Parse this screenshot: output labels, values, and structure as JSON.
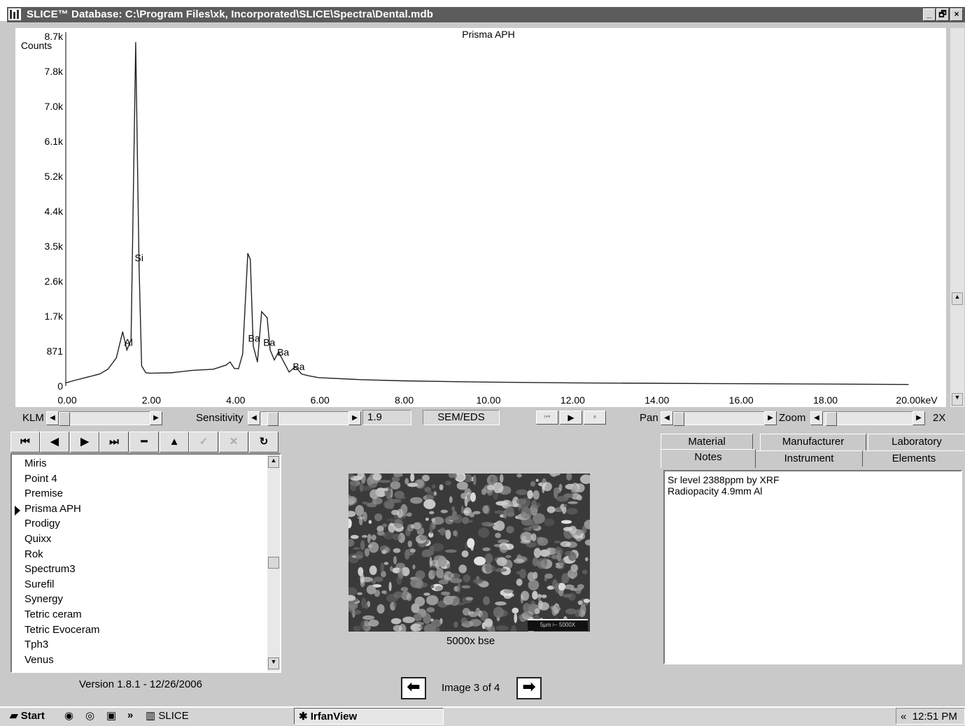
{
  "window": {
    "title": "SLICE™ Database: C:\\Program Files\\xk, Incorporated\\SLICE\\Spectra\\Dental.mdb",
    "btn_min": "_",
    "btn_max": "🗗",
    "btn_close": "×"
  },
  "chart_data": {
    "type": "line",
    "title": "Prisma APH",
    "ylabel": "Counts",
    "xlabel": "keV",
    "xlim": [
      0,
      20
    ],
    "ylim": [
      0,
      8700
    ],
    "y_ticks": [
      "8.7k",
      "7.8k",
      "7.0k",
      "6.1k",
      "5.2k",
      "4.4k",
      "3.5k",
      "2.6k",
      "1.7k",
      "871",
      "0"
    ],
    "x_ticks": [
      "0.00",
      "2.00",
      "4.00",
      "6.00",
      "8.00",
      "10.00",
      "12.00",
      "14.00",
      "16.00",
      "18.00",
      "20.00keV"
    ],
    "series": [
      {
        "x": [
          0.0,
          0.2,
          0.5,
          0.8,
          1.0,
          1.2,
          1.35,
          1.45,
          1.55,
          1.6,
          1.66,
          1.74,
          1.8,
          1.9,
          2.0,
          2.5,
          3.0,
          3.5,
          3.8,
          3.9,
          4.0,
          4.1,
          4.2,
          4.32,
          4.38,
          4.45,
          4.55,
          4.65,
          4.78,
          4.85,
          4.95,
          5.05,
          5.15,
          5.3,
          5.45,
          5.6,
          5.75,
          6.0,
          7.0,
          8.0,
          10.0,
          12.0,
          14.0,
          16.0,
          18.0,
          20.0
        ],
        "y": [
          80,
          140,
          220,
          300,
          420,
          700,
          1350,
          900,
          1150,
          4500,
          8550,
          3000,
          500,
          330,
          320,
          330,
          390,
          420,
          520,
          600,
          440,
          430,
          800,
          3300,
          3150,
          1000,
          600,
          1850,
          1700,
          900,
          650,
          850,
          650,
          350,
          480,
          300,
          260,
          210,
          160,
          130,
          100,
          80,
          70,
          60,
          50,
          40
        ]
      }
    ],
    "annotations": [
      {
        "label": "Si",
        "x": 1.74
      },
      {
        "label": "Al",
        "x": 1.49
      },
      {
        "label": "Ba",
        "x": 4.47
      },
      {
        "label": "Ba",
        "x": 4.83
      },
      {
        "label": "Ba",
        "x": 5.16
      },
      {
        "label": "Ba",
        "x": 5.53
      }
    ],
    "grid": false
  },
  "controls": {
    "klm_label": "KLM",
    "sensitivity_label": "Sensitivity",
    "sensitivity_value": "1.9",
    "mode_value": "SEM/EDS",
    "pan_label": "Pan",
    "zoom_label": "Zoom",
    "zoom_value": "2X"
  },
  "nav_toolbar": {
    "first": "⏮",
    "prev": "◀",
    "next": "▶",
    "last": "⏭",
    "delete": "━",
    "insert": "▲",
    "post": "✓",
    "cancel": "✕",
    "refresh": "↻"
  },
  "list": {
    "items": [
      "Miris",
      "Point 4",
      "Premise",
      "Prisma APH",
      "Prodigy",
      "Quixx",
      "Rok",
      "Spectrum3",
      "Surefil",
      "Synergy",
      "Tetric ceram",
      "Tetric Evoceram",
      "Tph3",
      "Venus"
    ],
    "selected": "Prisma APH"
  },
  "image": {
    "caption": "5000x bse",
    "scale_label": "5μm ⊢ 5000X",
    "counter": "Image 3 of 4",
    "prev": "⬅",
    "next": "➡"
  },
  "version": "Version 1.8.1 - 12/26/2006",
  "tabs": {
    "row1": [
      "Material",
      "Manufacturer",
      "Laboratory"
    ],
    "row2": [
      "Notes",
      "Instrument",
      "Elements"
    ],
    "active": "Notes"
  },
  "notes": {
    "line1": "Sr level 2388ppm by XRF",
    "line2": "Radiopacity 4.9mm Al"
  },
  "taskbar": {
    "start": "Start",
    "chevron": "»",
    "app1": "SLICE",
    "app2": "IrfanView",
    "tray_chevron": "«",
    "clock": "12:51 PM"
  }
}
